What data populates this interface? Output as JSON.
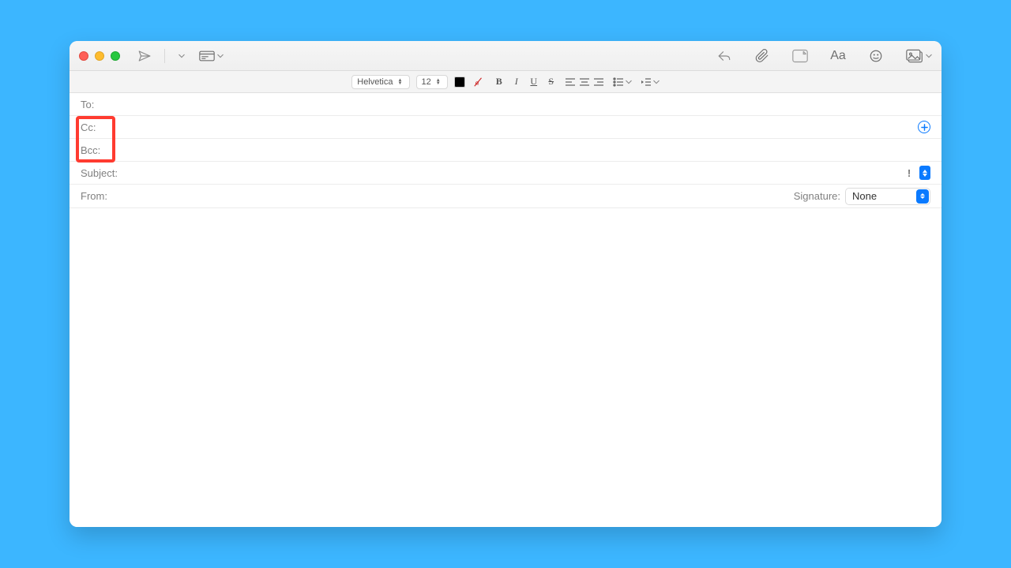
{
  "toolbar": {
    "send_icon": "send-icon",
    "header_dropdown_icon": "header-fields-icon",
    "reply_icon": "reply-icon",
    "attach_icon": "paperclip-icon",
    "link_icon": "link-card-icon",
    "font_icon": "font-icon",
    "font_label": "Aa",
    "emoji_icon": "emoji-icon",
    "media_icon": "photo-icon"
  },
  "formatbar": {
    "font_family": "Helvetica",
    "font_size": "12",
    "bold": "B",
    "italic": "I",
    "underline": "U",
    "strike": "S"
  },
  "fields": {
    "to_label": "To:",
    "cc_label": "Cc:",
    "bcc_label": "Bcc:",
    "subject_label": "Subject:",
    "from_label": "From:",
    "signature_label": "Signature:",
    "signature_value": "None",
    "priority_label": "!"
  },
  "values": {
    "to": "",
    "cc": "",
    "bcc": "",
    "subject": "",
    "from": ""
  }
}
